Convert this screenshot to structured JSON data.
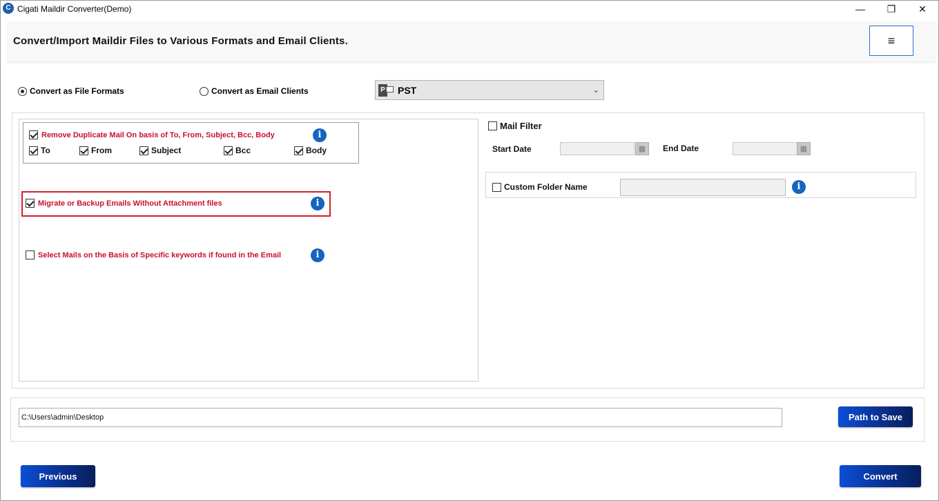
{
  "window": {
    "title": "Cigati Maildir Converter(Demo)",
    "controls": {
      "minimize": "—",
      "maximize": "❐",
      "close": "✕"
    }
  },
  "header": {
    "title": "Convert/Import Maildir Files to Various Formats and Email Clients.",
    "menu_icon": "≡"
  },
  "mode": {
    "file_formats_label": "Convert as File Formats",
    "email_clients_label": "Convert as Email Clients",
    "selected": "file_formats"
  },
  "format_select": {
    "value": "PST",
    "icon": "pst-file-icon"
  },
  "options": {
    "remove_duplicate": {
      "label": "Remove Duplicate Mail On basis of To, From, Subject, Bcc, Body",
      "checked": true,
      "fields": [
        {
          "label": "To",
          "checked": true
        },
        {
          "label": "From",
          "checked": true
        },
        {
          "label": "Subject",
          "checked": true
        },
        {
          "label": "Bcc",
          "checked": true
        },
        {
          "label": "Body",
          "checked": true
        }
      ]
    },
    "without_attachment": {
      "label": "Migrate or Backup Emails Without Attachment files",
      "checked": true
    },
    "keywords": {
      "label": "Select Mails on the Basis of Specific keywords if found in the Email",
      "checked": false
    }
  },
  "mail_filter": {
    "label": "Mail Filter",
    "checked": false,
    "start_date_label": "Start Date",
    "end_date_label": "End Date",
    "start_date_value": "",
    "end_date_value": ""
  },
  "custom_folder": {
    "label": "Custom Folder Name",
    "checked": false,
    "value": ""
  },
  "save": {
    "path": "C:\\Users\\admin\\Desktop",
    "button_label": "Path to Save"
  },
  "footer": {
    "previous_label": "Previous",
    "convert_label": "Convert"
  },
  "colors": {
    "accent_blue": "#0b4fd6",
    "warning_red": "#c8102e",
    "info_blue": "#1565c0"
  }
}
